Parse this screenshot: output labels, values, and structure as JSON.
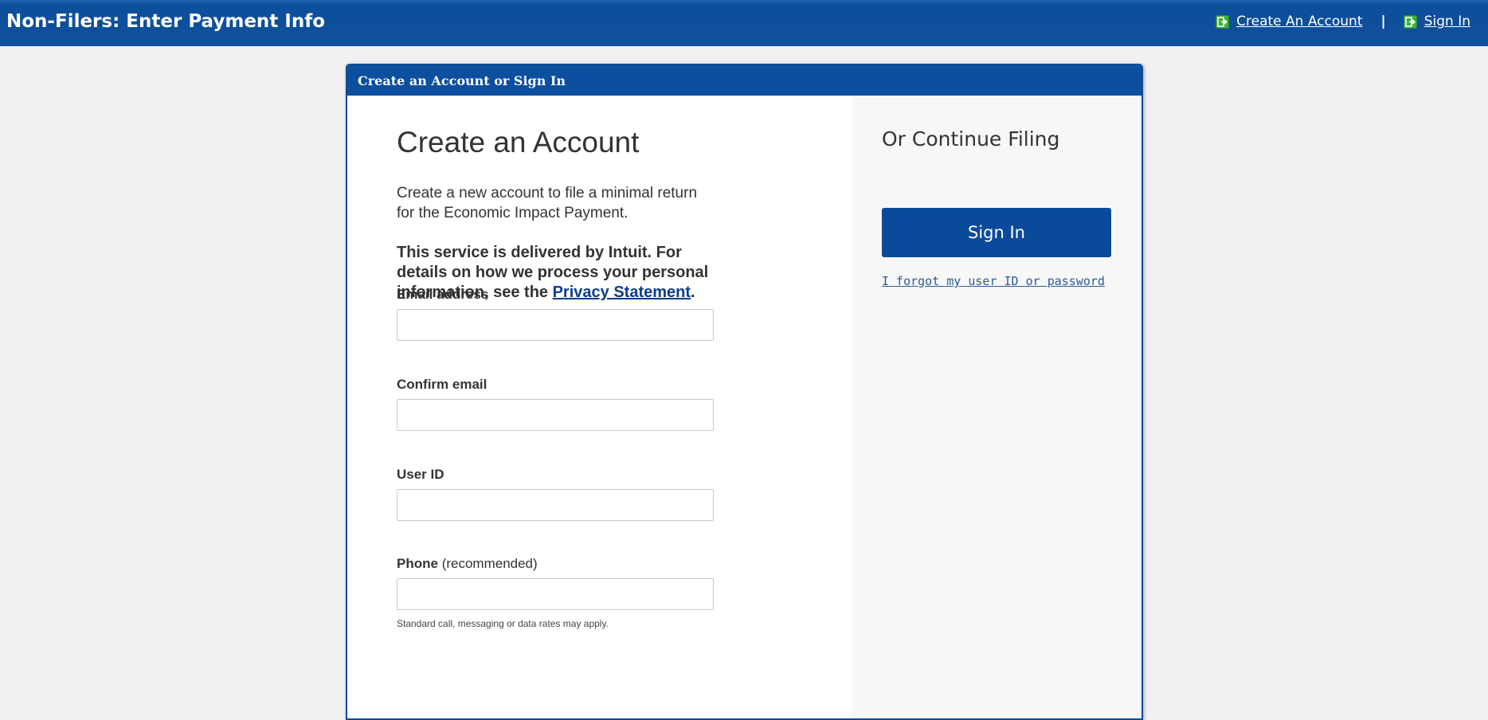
{
  "header": {
    "title": "Non-Filers: Enter Payment Info",
    "links": [
      {
        "label": "Create An Account",
        "icon": "exit-icon"
      },
      {
        "label": "Sign In",
        "icon": "exit-icon"
      }
    ],
    "separator": "|"
  },
  "card": {
    "header_title": "Create an Account or Sign In"
  },
  "create_account": {
    "title": "Create an Account",
    "intro": "Create a new account to file a minimal return for the Economic Impact Payment.",
    "notice_text": "This service is delivered by Intuit. For details on how we process your personal information, see the",
    "privacy_link": "Privacy Statement",
    "notice_end": ".",
    "fields": {
      "email": {
        "label": "Email address",
        "value": "",
        "placeholder": ""
      },
      "confirm_email": {
        "label": "Confirm email",
        "value": "",
        "placeholder": ""
      },
      "user_id": {
        "label": "User ID",
        "value": "",
        "placeholder": ""
      },
      "phone": {
        "label": "Phone",
        "label_optional": "(recommended)",
        "value": "",
        "placeholder": ""
      }
    },
    "phone_note": "Standard call, messaging or data rates may apply."
  },
  "continue_filing": {
    "title": "Or Continue Filing",
    "signin_button": "Sign In",
    "forgot_link": "I forgot my user ID or password"
  },
  "colors": {
    "header_blue": "#114f9a",
    "card_blue": "#0b4f9e",
    "button_blue": "#0a4a9a",
    "icon_green": "#3cb043",
    "page_bg": "#f1f1f1"
  }
}
